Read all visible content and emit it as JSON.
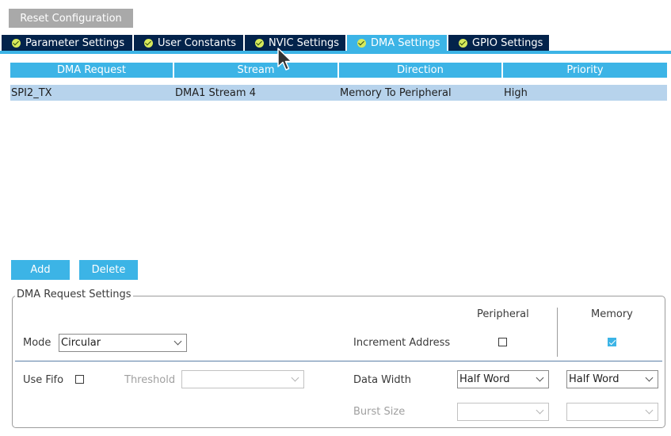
{
  "toolbar": {
    "reset_label": "Reset Configuration"
  },
  "tabs": [
    {
      "label": "Parameter Settings",
      "active": false
    },
    {
      "label": "User Constants",
      "active": false
    },
    {
      "label": "NVIC Settings",
      "active": false
    },
    {
      "label": "DMA Settings",
      "active": true
    },
    {
      "label": "GPIO Settings",
      "active": false
    }
  ],
  "table": {
    "columns": [
      "DMA Request",
      "Stream",
      "Direction",
      "Priority"
    ],
    "rows": [
      [
        "SPI2_TX",
        "DMA1 Stream 4",
        "Memory To Peripheral",
        "High"
      ]
    ]
  },
  "actions": {
    "add_label": "Add",
    "delete_label": "Delete"
  },
  "settings": {
    "title": "DMA Request Settings",
    "peripheral_header": "Peripheral",
    "memory_header": "Memory",
    "mode": {
      "label": "Mode",
      "value": "Circular"
    },
    "increment_address": {
      "label": "Increment Address",
      "peripheral": false,
      "memory": true
    },
    "use_fifo": {
      "label": "Use Fifo",
      "checked": false
    },
    "threshold": {
      "label": "Threshold",
      "value": ""
    },
    "data_width": {
      "label": "Data Width",
      "peripheral": "Half Word",
      "memory": "Half Word"
    },
    "burst_size": {
      "label": "Burst Size",
      "peripheral": "",
      "memory": ""
    }
  },
  "colors": {
    "accent": "#3cb4e6",
    "tab_dark": "#03234b",
    "selected_row": "#b7d3ec",
    "reset_button": "#a9a9a9",
    "check_badge": "#d7e95a"
  }
}
